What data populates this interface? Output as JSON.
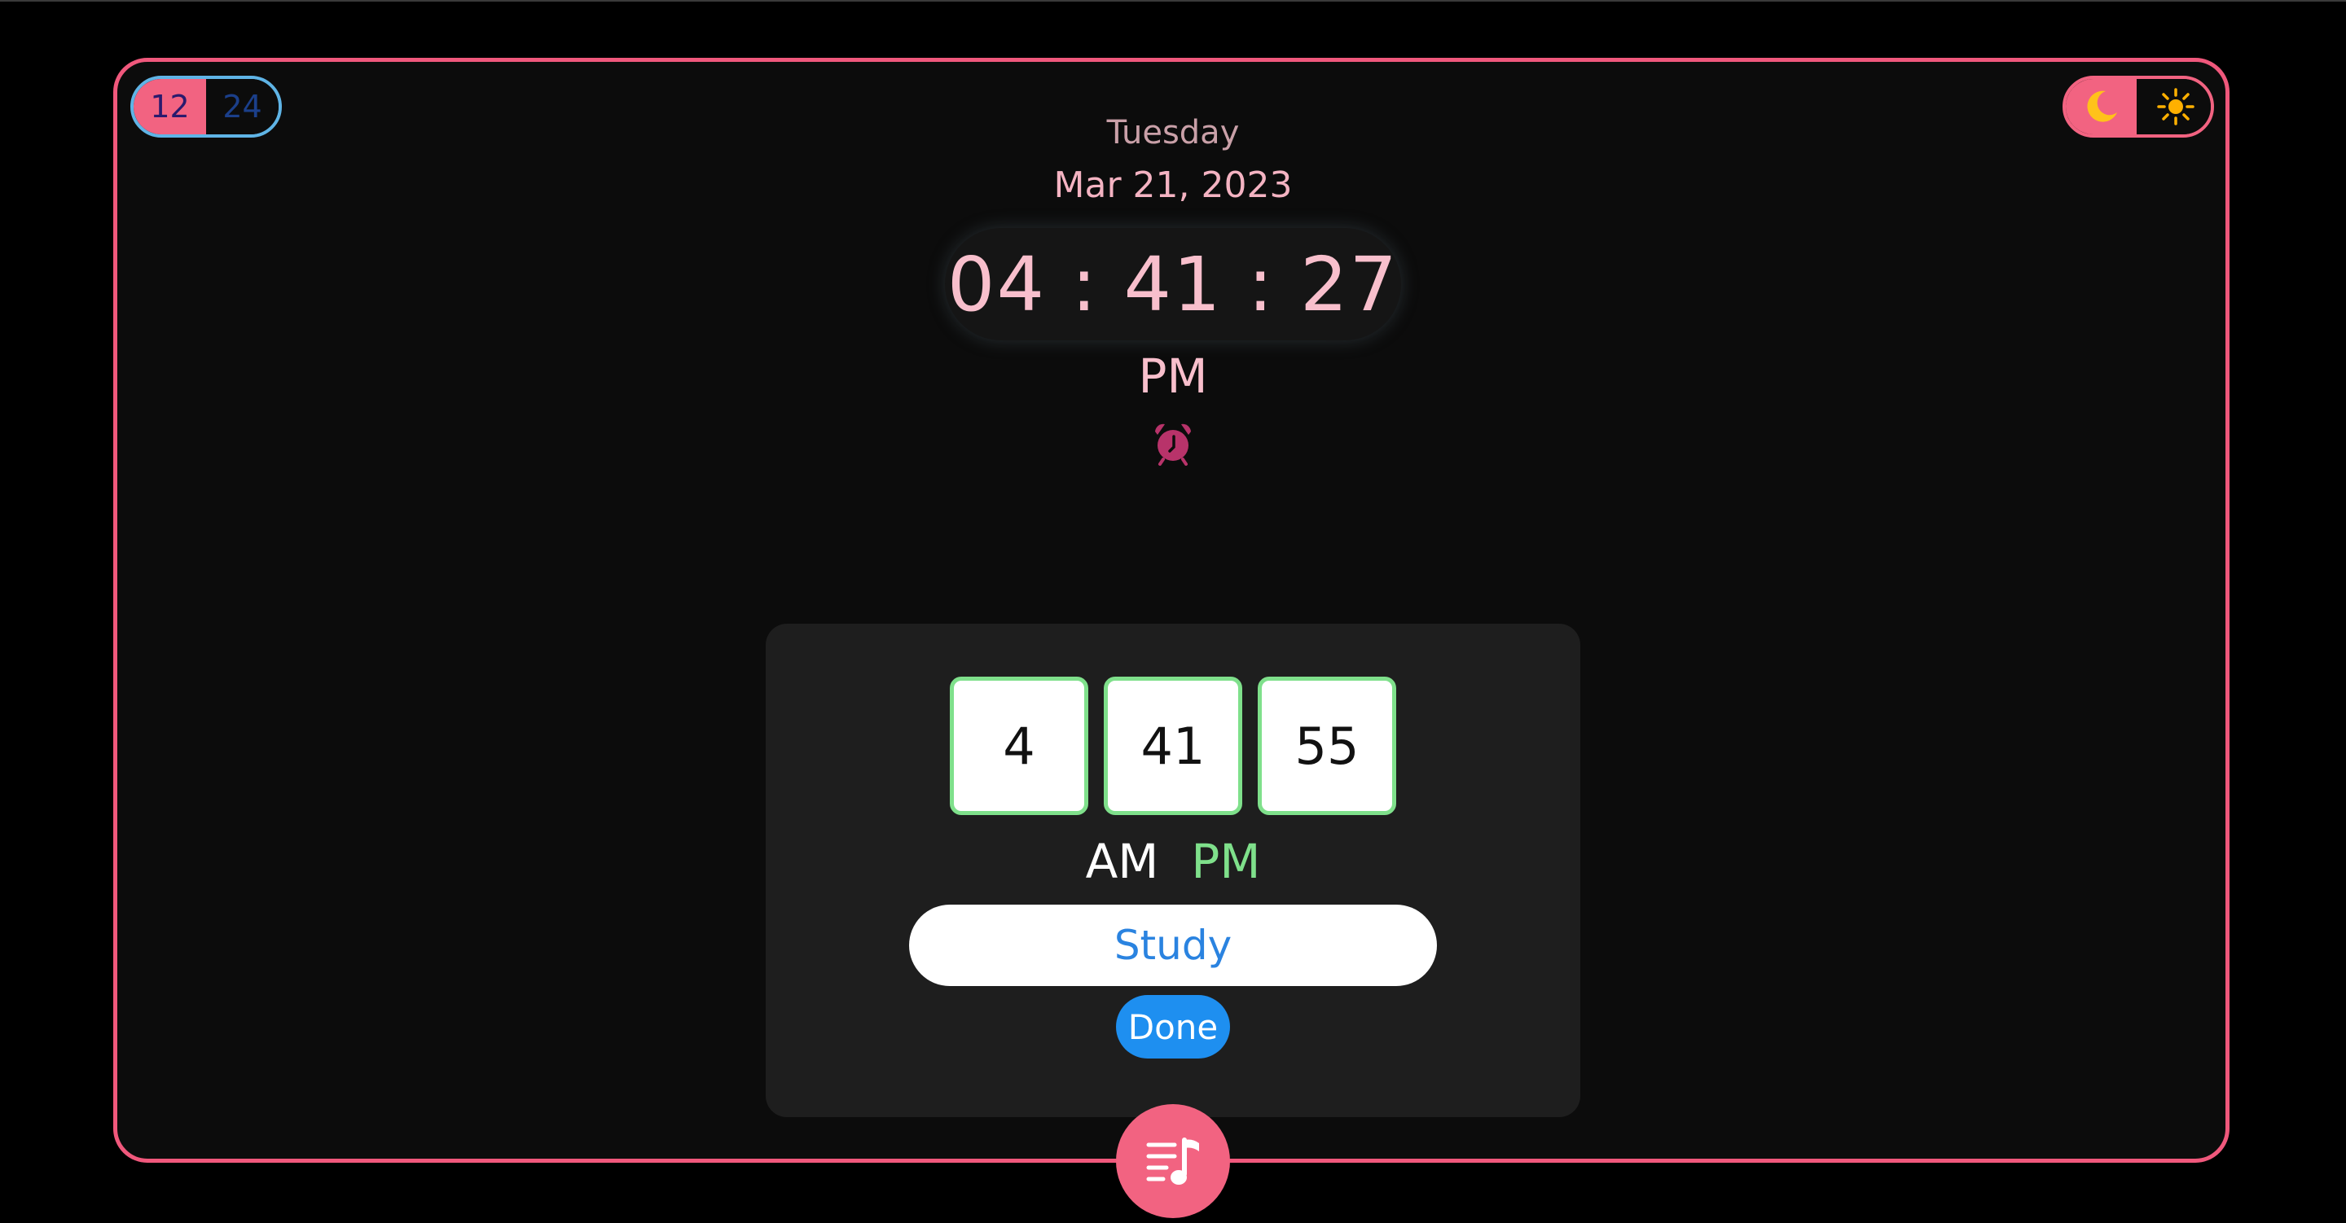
{
  "format_toggle": {
    "option_12": "12",
    "option_24": "24",
    "selected": "12"
  },
  "theme_toggle": {
    "selected": "dark",
    "dark_icon": "moon-icon",
    "light_icon": "sun-icon"
  },
  "clock": {
    "day": "Tuesday",
    "date": "Mar 21, 2023",
    "time": "04 : 41 : 27",
    "meridiem": "PM",
    "alarm_icon": "alarm-clock-icon"
  },
  "alarm_form": {
    "hour": "4",
    "minute": "41",
    "second": "55",
    "am_label": "AM",
    "pm_label": "PM",
    "selected_meridiem": "PM",
    "label_value": "Study",
    "done_label": "Done"
  },
  "music_button": {
    "icon": "playlist-music-icon"
  },
  "colors": {
    "accent": "#f26381",
    "selected_green": "#7fe08b",
    "primary_blue": "#1e8ff0",
    "clock_text": "#f8bfcc"
  }
}
